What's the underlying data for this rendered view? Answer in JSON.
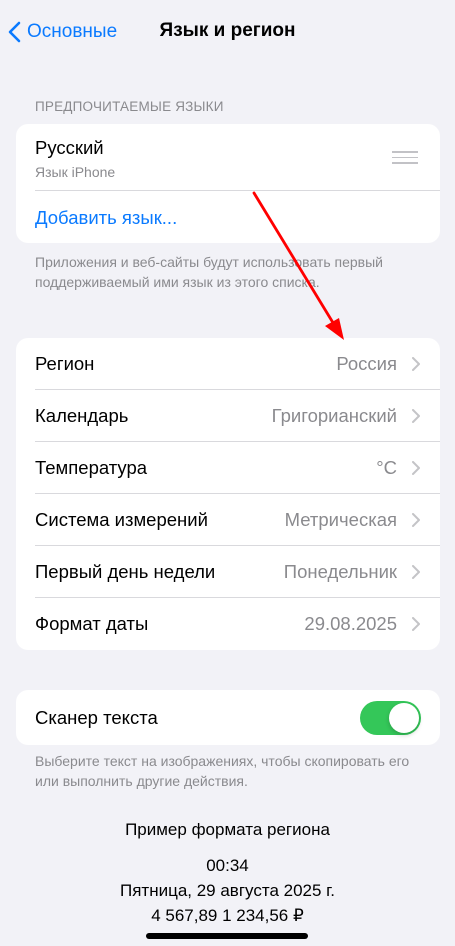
{
  "nav": {
    "back_label": "Основные",
    "title": "Язык и регион"
  },
  "languages": {
    "header": "ПРЕДПОЧИТАЕМЫЕ ЯЗЫКИ",
    "items": [
      {
        "name": "Русский",
        "subtitle": "Язык iPhone"
      }
    ],
    "add_label": "Добавить язык...",
    "footer": "Приложения и веб-сайты будут использовать первый поддерживаемый ими язык из этого списка."
  },
  "region_settings": [
    {
      "label": "Регион",
      "value": "Россия"
    },
    {
      "label": "Календарь",
      "value": "Григорианский"
    },
    {
      "label": "Температура",
      "value": "°C"
    },
    {
      "label": "Система измерений",
      "value": "Метрическая"
    },
    {
      "label": "Первый день недели",
      "value": "Понедельник"
    },
    {
      "label": "Формат даты",
      "value": "29.08.2025"
    }
  ],
  "live_text": {
    "label": "Сканер текста",
    "enabled": true,
    "footer": "Выберите текст на изображениях, чтобы скопировать его или выполнить другие действия."
  },
  "example": {
    "title": "Пример формата региона",
    "time": "00:34",
    "date": "Пятница, 29 августа 2025 г.",
    "numbers": "4 567,89 1 234,56 ₽"
  },
  "colors": {
    "accent": "#0a7aff",
    "toggle_on": "#34c759",
    "annotation_arrow": "#ff0000",
    "background": "#f2f2f7"
  }
}
